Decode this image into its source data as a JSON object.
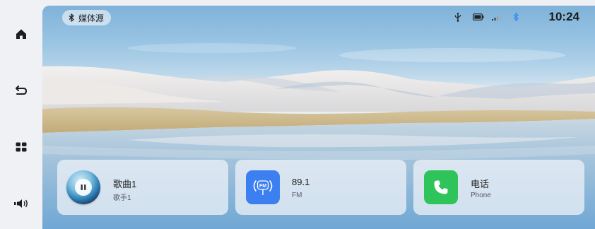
{
  "status_bar": {
    "source_label": "媒体源",
    "time": "10:24",
    "icons": [
      "bluetooth-icon",
      "usb-icon",
      "battery-icon",
      "signal-icon",
      "bluetooth-status-icon"
    ]
  },
  "sidebar": {
    "items": [
      {
        "icon": "home-icon"
      },
      {
        "icon": "back-icon"
      },
      {
        "icon": "apps-grid-icon"
      },
      {
        "icon": "volume-icon"
      }
    ]
  },
  "cards": {
    "music": {
      "title": "歌曲1",
      "subtitle": "歌手1",
      "icon": "pause-icon"
    },
    "radio": {
      "title": "89.1",
      "subtitle": "FM",
      "icon": "fm-radio-icon",
      "badge": "FM"
    },
    "phone": {
      "title": "电话",
      "subtitle": "Phone",
      "icon": "phone-icon"
    }
  },
  "colors": {
    "radio_tile": "#3b7ff0",
    "phone_tile": "#2fc45a",
    "bluetooth_accent": "#3c8cf0"
  }
}
